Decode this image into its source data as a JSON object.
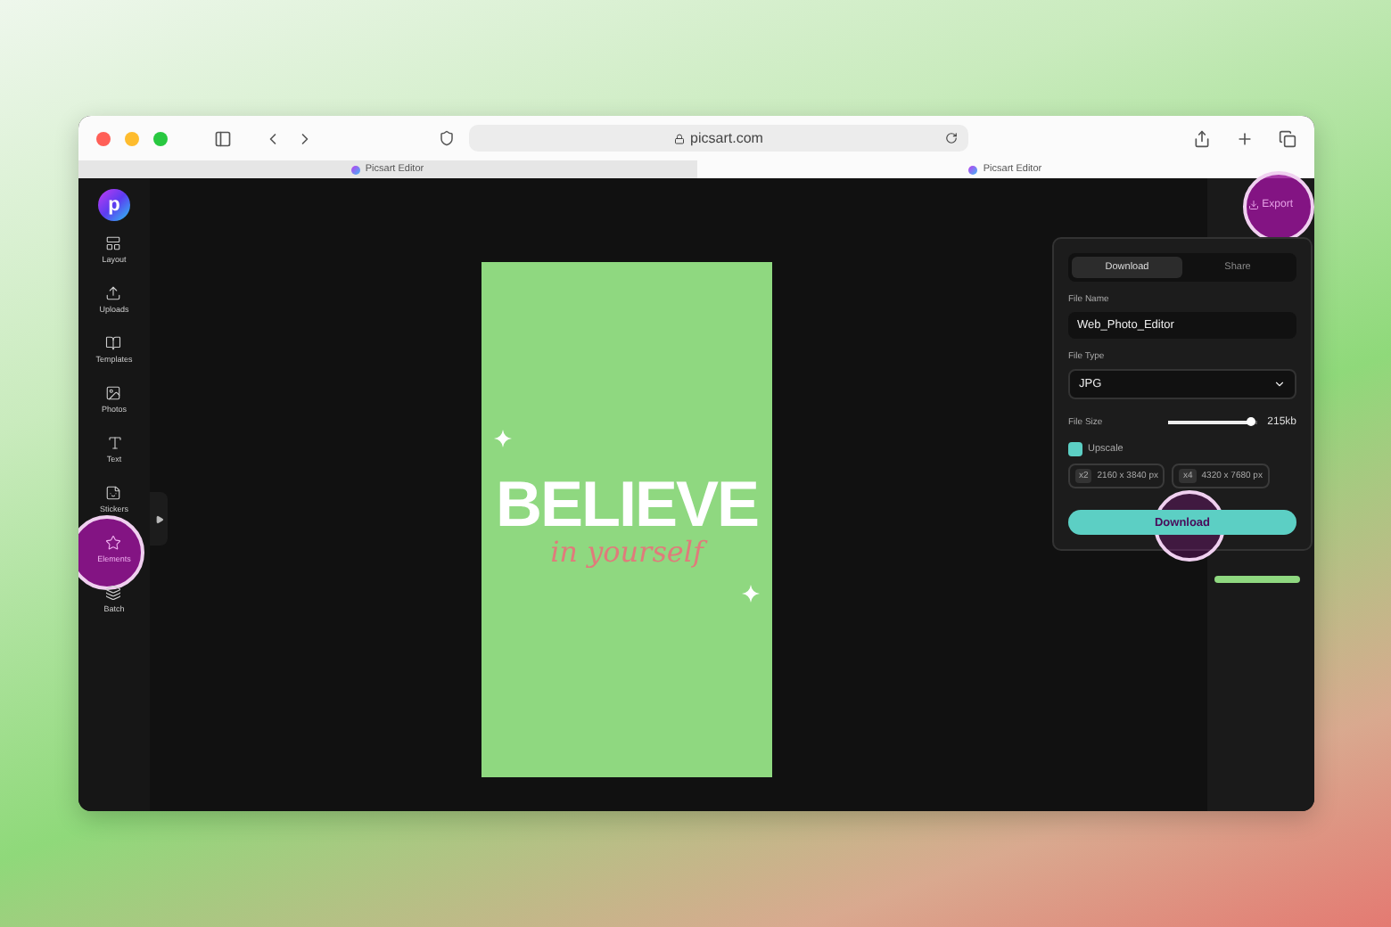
{
  "browser": {
    "address": "picsart.com",
    "tabs": [
      {
        "label": "Picsart Editor",
        "selected": false
      },
      {
        "label": "Picsart Editor",
        "selected": true
      }
    ]
  },
  "sidebar": {
    "items": [
      {
        "label": "Layout",
        "highlighted": false
      },
      {
        "label": "Uploads",
        "highlighted": false
      },
      {
        "label": "Templates",
        "highlighted": false
      },
      {
        "label": "Photos",
        "highlighted": false
      },
      {
        "label": "Text",
        "highlighted": false
      },
      {
        "label": "Stickers",
        "highlighted": false
      },
      {
        "label": "Elements",
        "highlighted": true
      },
      {
        "label": "Batch",
        "highlighted": false
      }
    ]
  },
  "app_logo": "p",
  "artboard": {
    "headline": "BELIEVE",
    "script": "in yourself"
  },
  "export_button": {
    "label": "Export",
    "highlighted": true
  },
  "export_panel": {
    "tabs": [
      {
        "label": "Download",
        "selected": true
      },
      {
        "label": "Share",
        "selected": false
      }
    ],
    "file_name": {
      "label": "File Name",
      "value": "Web_Photo_Editor"
    },
    "file_type": {
      "label": "File Type",
      "value": "JPG"
    },
    "file_size": {
      "label": "File Size",
      "level": 0.92,
      "reading": "215kb"
    },
    "upscale": {
      "label": "Upscale",
      "checked": true
    },
    "options": [
      {
        "badge": "x2",
        "label": "2160 x 3840 px"
      },
      {
        "badge": "x4",
        "label": "4320 x 7680 px"
      }
    ],
    "download_button": {
      "label": "Download",
      "highlighted": true
    }
  }
}
